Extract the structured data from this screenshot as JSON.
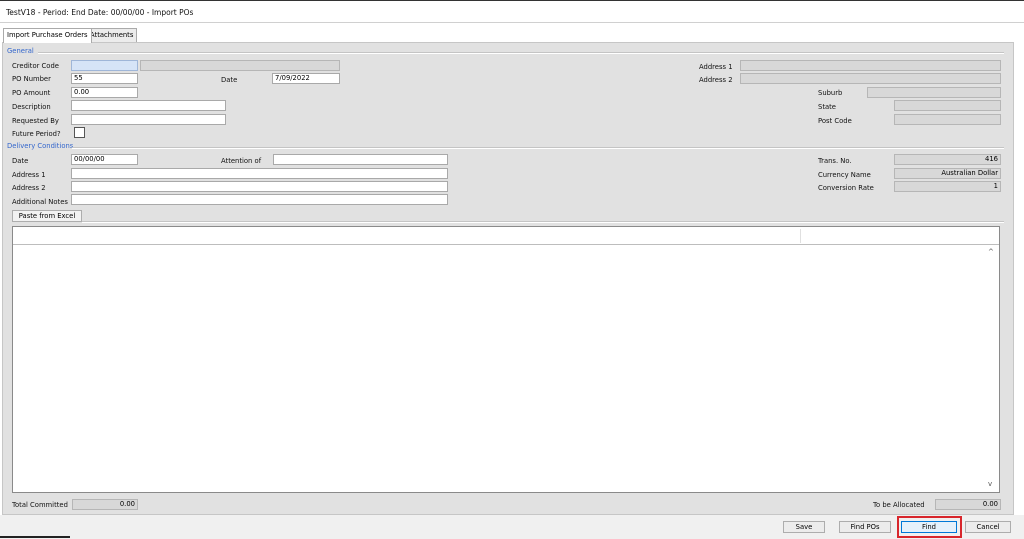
{
  "window": {
    "title": "TestV18  - Period:  End Date: 00/00/00 - Import POs"
  },
  "tabs": [
    {
      "label": "Import Purchase Orders"
    },
    {
      "label": "Attachments"
    }
  ],
  "general": {
    "section_title": "General",
    "creditor_code": {
      "label": "Creditor Code",
      "value": "",
      "name_value": ""
    },
    "po_number": {
      "label": "PO Number",
      "value": "55"
    },
    "date": {
      "label": "Date",
      "value": "7/09/2022"
    },
    "po_amount": {
      "label": "PO Amount",
      "value": "0.00"
    },
    "description": {
      "label": "Description",
      "value": ""
    },
    "requested_by": {
      "label": "Requested By",
      "value": ""
    },
    "future_period": {
      "label": "Future Period?",
      "checked": false
    },
    "address1": {
      "label": "Address 1",
      "value": ""
    },
    "address2": {
      "label": "Address 2",
      "value": ""
    },
    "suburb": {
      "label": "Suburb",
      "value": ""
    },
    "state": {
      "label": "State",
      "value": ""
    },
    "post_code": {
      "label": "Post Code",
      "value": ""
    }
  },
  "delivery": {
    "section_title": "Delivery Conditions",
    "date": {
      "label": "Date",
      "value": "00/00/00"
    },
    "attention_of": {
      "label": "Attention of",
      "value": ""
    },
    "address1": {
      "label": "Address 1",
      "value": ""
    },
    "address2": {
      "label": "Address 2",
      "value": ""
    },
    "additional_notes": {
      "label": "Additional Notes",
      "value": ""
    },
    "trans_no": {
      "label": "Trans. No.",
      "value": "416"
    },
    "currency_name": {
      "label": "Currency Name",
      "value": "Australian Dollar"
    },
    "conversion_rate": {
      "label": "Conversion Rate",
      "value": "1"
    }
  },
  "paste_button": {
    "label": "Paste from Excel"
  },
  "totals": {
    "total_committed": {
      "label": "Total Committed",
      "value": "0.00"
    },
    "to_be_allocated": {
      "label": "To be Allocated",
      "value": "0.00"
    }
  },
  "footer_buttons": {
    "save": "Save",
    "find_pos": "Find POs",
    "find": "Find",
    "cancel": "Cancel"
  },
  "colors": {
    "section_title": "#3366cc",
    "highlight": "#d8262c",
    "panel": "#e1e1e1"
  },
  "icons": {
    "scroll_up": "chevron-up-icon",
    "scroll_down": "chevron-down-icon"
  }
}
